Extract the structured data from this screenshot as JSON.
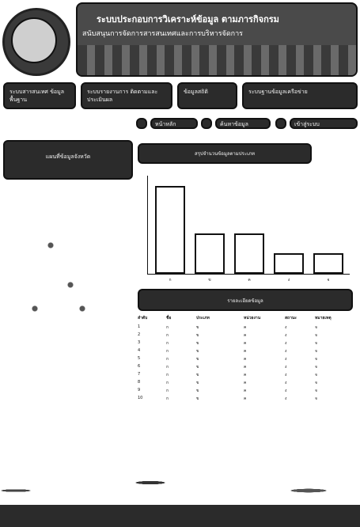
{
  "header": {
    "title": "ระบบประกอบการวิเคราะห์ข้อมูล ตามภารกิจกรม",
    "subtitle": "สนับสนุนการจัดการสารสนเทศและการบริหารจัดการ"
  },
  "nav": [
    {
      "label": "ระบบสารสนเทศ ข้อมูลพื้นฐาน"
    },
    {
      "label": "ระบบรายงานการ ติดตามและประเมินผล"
    },
    {
      "label": "ข้อมูลสถิติ"
    },
    {
      "label": "ระบบฐานข้อมูลเครือข่าย"
    }
  ],
  "toolbar": [
    {
      "label": "หน้าหลัก"
    },
    {
      "label": "ค้นหาข้อมูล"
    },
    {
      "label": "เข้าสู่ระบบ"
    }
  ],
  "side_button": {
    "label": "แผนที่ข้อมูลจังหวัด"
  },
  "chart_header": "สรุปจำนวนข้อมูลตามประเภท",
  "chart_data": {
    "type": "bar",
    "categories": [
      "ก",
      "ข",
      "ค",
      "ง",
      "จ"
    ],
    "values": [
      120,
      55,
      55,
      28,
      28
    ],
    "ylim": [
      0,
      130
    ]
  },
  "table": {
    "title": "รายละเอียดข้อมูล",
    "headers": [
      "ลำดับ",
      "ชื่อ",
      "ประเภท",
      "หน่วยงาน",
      "สถานะ",
      "หมายเหตุ"
    ],
    "rows": [
      [
        "1",
        "ก",
        "ข",
        "ค",
        "ง",
        "จ"
      ],
      [
        "2",
        "ก",
        "ข",
        "ค",
        "ง",
        "จ"
      ],
      [
        "3",
        "ก",
        "ข",
        "ค",
        "ง",
        "จ"
      ],
      [
        "4",
        "ก",
        "ข",
        "ค",
        "ง",
        "จ"
      ],
      [
        "5",
        "ก",
        "ข",
        "ค",
        "ง",
        "จ"
      ],
      [
        "6",
        "ก",
        "ข",
        "ค",
        "ง",
        "จ"
      ],
      [
        "7",
        "ก",
        "ข",
        "ค",
        "ง",
        "จ"
      ],
      [
        "8",
        "ก",
        "ข",
        "ค",
        "ง",
        "จ"
      ],
      [
        "9",
        "ก",
        "ข",
        "ค",
        "ง",
        "จ"
      ],
      [
        "10",
        "ก",
        "ข",
        "ค",
        "ง",
        "จ"
      ]
    ]
  }
}
